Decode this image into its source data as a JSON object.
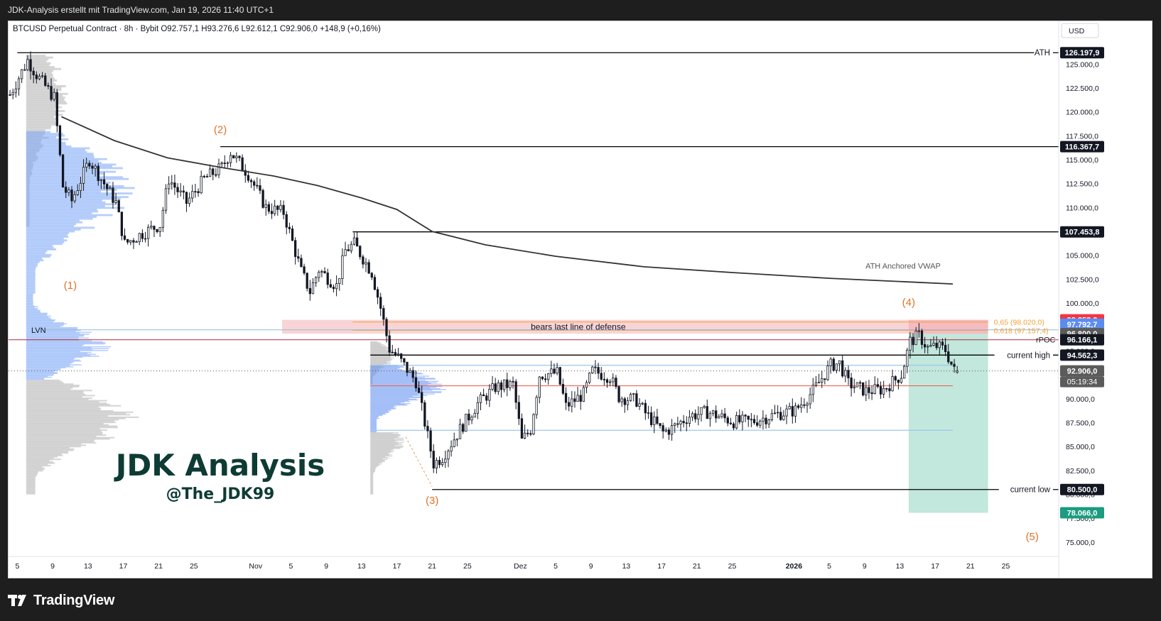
{
  "header": {
    "title": "JDK-Analysis erstellt mit TradingView.com, Jan 19, 2026 11:40 UTC+1"
  },
  "symbol_line": "BTCUSD Perpetual Contract · 8h · Bybit  O92.757,1  H93.276,6  L92.612,1  C92.906,0  +148,9 (+0,16%)",
  "currency_button": "USD",
  "footer": {
    "brand": "TradingView"
  },
  "watermark": {
    "title": "JDK Analysis",
    "handle": "@The_JDK99"
  },
  "colors": {
    "accent": "#e0722a",
    "watermark": "#0e3b34",
    "vwap": "#333333",
    "zone_red": "#f7c5c8",
    "zone_green": "#8fd4c0",
    "badge_red": "#f23645",
    "badge_blue": "#5b8def",
    "badge_green": "#1b9b7f"
  },
  "chart_data": {
    "type": "candlestick",
    "ylim": [
      73500,
      127700
    ],
    "y_ticks": [
      75000,
      77500,
      80000,
      82500,
      85000,
      87500,
      90000,
      92500,
      95000,
      97500,
      100000,
      102500,
      105000,
      107500,
      110000,
      112500,
      115000,
      117500,
      120000,
      122500,
      125000
    ],
    "y_tick_labels": [
      "75.000,0",
      "77.500,0",
      "80.000,0",
      "82.500,0",
      "85.000,0",
      "87.500,0",
      "90.000,0",
      "92.500,0",
      "95.000,0",
      "97.500,0",
      "100.000,0",
      "102.500,0",
      "105.000,0",
      "107.500,0",
      "110.000,0",
      "112.500,0",
      "115.000,0",
      "117.500,0",
      "120.000,0",
      "122.500,0",
      "125.000,0"
    ],
    "x_ticks": [
      {
        "d": "2025-10-05",
        "label": "5",
        "bold": false
      },
      {
        "d": "2025-10-09",
        "label": "9",
        "bold": false
      },
      {
        "d": "2025-10-13",
        "label": "13",
        "bold": false
      },
      {
        "d": "2025-10-17",
        "label": "17",
        "bold": false
      },
      {
        "d": "2025-10-21",
        "label": "21",
        "bold": false
      },
      {
        "d": "2025-10-25",
        "label": "25",
        "bold": false
      },
      {
        "d": "2025-11-01",
        "label": "Nov",
        "bold": false
      },
      {
        "d": "2025-11-05",
        "label": "5",
        "bold": false
      },
      {
        "d": "2025-11-09",
        "label": "9",
        "bold": false
      },
      {
        "d": "2025-11-13",
        "label": "13",
        "bold": false
      },
      {
        "d": "2025-11-17",
        "label": "17",
        "bold": false
      },
      {
        "d": "2025-11-21",
        "label": "21",
        "bold": false
      },
      {
        "d": "2025-11-25",
        "label": "25",
        "bold": false
      },
      {
        "d": "2025-12-01",
        "label": "Dez",
        "bold": false
      },
      {
        "d": "2025-12-05",
        "label": "5",
        "bold": false
      },
      {
        "d": "2025-12-09",
        "label": "9",
        "bold": false
      },
      {
        "d": "2025-12-13",
        "label": "13",
        "bold": false
      },
      {
        "d": "2025-12-17",
        "label": "17",
        "bold": false
      },
      {
        "d": "2025-12-21",
        "label": "21",
        "bold": false
      },
      {
        "d": "2025-12-25",
        "label": "25",
        "bold": false
      },
      {
        "d": "2026-01-01",
        "label": "2026",
        "bold": true
      },
      {
        "d": "2026-01-05",
        "label": "5",
        "bold": false
      },
      {
        "d": "2026-01-09",
        "label": "9",
        "bold": false
      },
      {
        "d": "2026-01-13",
        "label": "13",
        "bold": false
      },
      {
        "d": "2026-01-17",
        "label": "17",
        "bold": false
      },
      {
        "d": "2026-01-21",
        "label": "21",
        "bold": false
      },
      {
        "d": "2026-01-25",
        "label": "25",
        "bold": false
      }
    ],
    "x_range": [
      "2025-10-04T00:00",
      "2026-01-31T00:00"
    ],
    "ohlc_anchors": [
      {
        "d": "2025-10-04",
        "close": 121800
      },
      {
        "d": "2025-10-06",
        "close": 125400
      },
      {
        "d": "2025-10-07",
        "close": 123900
      },
      {
        "d": "2025-10-09",
        "close": 121500
      },
      {
        "d": "2025-10-10",
        "close": 112200
      },
      {
        "d": "2025-10-11",
        "close": 110700
      },
      {
        "d": "2025-10-13",
        "close": 115000
      },
      {
        "d": "2025-10-16",
        "close": 110500
      },
      {
        "d": "2025-10-17",
        "close": 106200
      },
      {
        "d": "2025-10-19",
        "close": 107300
      },
      {
        "d": "2025-10-21",
        "close": 108200
      },
      {
        "d": "2025-10-22",
        "close": 113000
      },
      {
        "d": "2025-10-24",
        "close": 110500
      },
      {
        "d": "2025-10-26",
        "close": 113000
      },
      {
        "d": "2025-10-28",
        "close": 114200
      },
      {
        "d": "2025-10-29",
        "close": 115800
      },
      {
        "d": "2025-10-31",
        "close": 113500
      },
      {
        "d": "2025-11-02",
        "close": 110000
      },
      {
        "d": "2025-11-04",
        "close": 109500
      },
      {
        "d": "2025-11-06",
        "close": 103300
      },
      {
        "d": "2025-11-07",
        "close": 101200
      },
      {
        "d": "2025-11-08",
        "close": 103500
      },
      {
        "d": "2025-11-10",
        "close": 101800
      },
      {
        "d": "2025-11-11",
        "close": 105500
      },
      {
        "d": "2025-11-12",
        "close": 106200
      },
      {
        "d": "2025-11-14",
        "close": 103200
      },
      {
        "d": "2025-11-15",
        "close": 99500
      },
      {
        "d": "2025-11-16",
        "close": 95200
      },
      {
        "d": "2025-11-17",
        "close": 94300
      },
      {
        "d": "2025-11-19",
        "close": 91800
      },
      {
        "d": "2025-11-20",
        "close": 87500
      },
      {
        "d": "2025-11-21",
        "close": 83200
      },
      {
        "d": "2025-11-22",
        "close": 83900
      },
      {
        "d": "2025-11-24",
        "close": 86800
      },
      {
        "d": "2025-11-26",
        "close": 89500
      },
      {
        "d": "2025-11-28",
        "close": 91200
      },
      {
        "d": "2025-11-30",
        "close": 91500
      },
      {
        "d": "2025-12-01",
        "close": 85600
      },
      {
        "d": "2025-12-02",
        "close": 86800
      },
      {
        "d": "2025-12-03",
        "close": 92500
      },
      {
        "d": "2025-12-05",
        "close": 92700
      },
      {
        "d": "2025-12-06",
        "close": 89200
      },
      {
        "d": "2025-12-08",
        "close": 90500
      },
      {
        "d": "2025-12-09",
        "close": 92900
      },
      {
        "d": "2025-12-11",
        "close": 92300
      },
      {
        "d": "2025-12-12",
        "close": 90200
      },
      {
        "d": "2025-12-14",
        "close": 89800
      },
      {
        "d": "2025-12-15",
        "close": 88500
      },
      {
        "d": "2025-12-17",
        "close": 86500
      },
      {
        "d": "2025-12-18",
        "close": 86900
      },
      {
        "d": "2025-12-20",
        "close": 88200
      },
      {
        "d": "2025-12-22",
        "close": 88600
      },
      {
        "d": "2025-12-25",
        "close": 87600
      },
      {
        "d": "2025-12-27",
        "close": 87600
      },
      {
        "d": "2025-12-30",
        "close": 88400
      },
      {
        "d": "2026-01-01",
        "close": 88800
      },
      {
        "d": "2026-01-03",
        "close": 90800
      },
      {
        "d": "2026-01-05",
        "close": 93500
      },
      {
        "d": "2026-01-06",
        "close": 93700
      },
      {
        "d": "2026-01-07",
        "close": 91600
      },
      {
        "d": "2026-01-09",
        "close": 90800
      },
      {
        "d": "2026-01-11",
        "close": 91000
      },
      {
        "d": "2026-01-13",
        "close": 92500
      },
      {
        "d": "2026-01-14",
        "close": 96000
      },
      {
        "d": "2026-01-15",
        "close": 96600
      },
      {
        "d": "2026-01-16",
        "close": 95300
      },
      {
        "d": "2026-01-17",
        "close": 95500
      },
      {
        "d": "2026-01-18",
        "close": 95100
      },
      {
        "d": "2026-01-19",
        "close": 92906
      }
    ],
    "vwap": {
      "label": "ATH Anchored VWAP",
      "points": [
        {
          "d": "2025-10-10",
          "v": 119500
        },
        {
          "d": "2025-10-16",
          "v": 117000
        },
        {
          "d": "2025-10-22",
          "v": 115200
        },
        {
          "d": "2025-10-28",
          "v": 114200
        },
        {
          "d": "2025-11-03",
          "v": 113300
        },
        {
          "d": "2025-11-08",
          "v": 112300
        },
        {
          "d": "2025-11-13",
          "v": 111000
        },
        {
          "d": "2025-11-17",
          "v": 109800
        },
        {
          "d": "2025-11-21",
          "v": 107500
        },
        {
          "d": "2025-11-27",
          "v": 106100
        },
        {
          "d": "2025-12-05",
          "v": 104900
        },
        {
          "d": "2025-12-15",
          "v": 103800
        },
        {
          "d": "2025-12-25",
          "v": 103200
        },
        {
          "d": "2026-01-05",
          "v": 102600
        },
        {
          "d": "2026-01-19",
          "v": 102000
        }
      ]
    },
    "levels": [
      {
        "label": "ATH",
        "value": 126197.9,
        "price_label": "126.197,9",
        "from": "2025-10-05",
        "color": "#000000"
      },
      {
        "label": "",
        "value": 116367.7,
        "price_label": "116.367,7",
        "from": "2025-10-28",
        "color": "#000000"
      },
      {
        "label": "",
        "value": 107453.8,
        "price_label": "107.453,8",
        "from": "2025-11-12",
        "color": "#000000"
      },
      {
        "label": "current high",
        "value": 94562.3,
        "price_label": "94.562,3",
        "from": "2025-11-14",
        "color": "#000000"
      },
      {
        "label": "current low",
        "value": 80500.0,
        "price_label": "80.500,0",
        "from": "2025-11-21",
        "color": "#000000"
      }
    ],
    "price_badges": [
      {
        "value": 98253.2,
        "text": "98.253,2",
        "bg": "#f23645",
        "fg": "#ffffff"
      },
      {
        "value": 97792.7,
        "text": "97.792,7",
        "bg": "#5b8def",
        "fg": "#ffffff"
      },
      {
        "value": 96800.0,
        "text": "96.800,0",
        "bg": "#5b5b5b",
        "fg": "#ffffff"
      },
      {
        "value": 96166.1,
        "text": "96.166,1",
        "bg": "#131722",
        "fg": "#ffffff"
      },
      {
        "value": 92906.0,
        "text": "92.906,0",
        "bg": "#5b5b5b",
        "fg": "#ffffff"
      },
      {
        "value": 78066.0,
        "text": "78.066,0",
        "bg": "#1b9b7f",
        "fg": "#ffffff"
      }
    ],
    "countdown": "05:19:34",
    "lvn": {
      "label": "LVN",
      "value": 97200
    },
    "rpoc": {
      "label": "rPOC",
      "value": 96166.1
    },
    "extra_lines": [
      {
        "value": 93500,
        "from": "2025-11-14",
        "to": "2026-01-19",
        "color": "#9ec7ee"
      },
      {
        "value": 91350,
        "from": "2025-11-14",
        "to": "2026-01-19",
        "color": "#e8675b"
      },
      {
        "value": 86700,
        "from": "2025-11-14",
        "to": "2026-01-19",
        "color": "#9ec7ee"
      }
    ],
    "zone_bears": {
      "label": "bears last line of defense",
      "top": 98253.2,
      "bottom": 96800,
      "from": "2025-11-04",
      "to": "2026-01-23"
    },
    "fib": [
      {
        "text": "0,65 (98.020,0)",
        "value": 98020,
        "color": "#f0a13a"
      },
      {
        "text": "0,618 (97.157,4)",
        "value": 97157.4,
        "color": "#f0a13a"
      }
    ],
    "long_box": {
      "entry": 96800,
      "target": 78066,
      "from": "2026-01-14",
      "to": "2026-01-23"
    },
    "wave_labels": [
      {
        "text": "(1)",
        "d": "2025-10-11",
        "v": 101500
      },
      {
        "text": "(2)",
        "d": "2025-10-28",
        "v": 117800
      },
      {
        "text": "(3)",
        "d": "2025-11-21",
        "v": 79000
      },
      {
        "text": "(4)",
        "d": "2026-01-14",
        "v": 99700
      },
      {
        "text": "(5)",
        "d": "2026-01-28",
        "v": 75200
      }
    ]
  }
}
